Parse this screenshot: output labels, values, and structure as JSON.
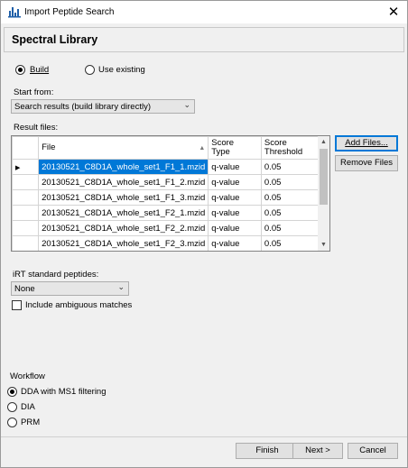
{
  "window": {
    "title": "Import Peptide Search",
    "close_glyph": "✕"
  },
  "header": {
    "title": "Spectral Library"
  },
  "library_mode": {
    "build_label": "Build",
    "use_existing_label": "Use existing",
    "selected": "Build"
  },
  "start_from": {
    "label": "Start from:",
    "value": "Search results (build library directly)"
  },
  "result_files": {
    "label": "Result files:",
    "columns": [
      "File",
      "Score Type",
      "Score Threshold"
    ],
    "column_lines": {
      "score_type": [
        "Score",
        "Type"
      ],
      "score_threshold": [
        "Score",
        "Threshold"
      ]
    },
    "rows": [
      {
        "file": "20130521_C8D1A_whole_set1_F1_1.mzid",
        "score_type": "q-value",
        "threshold": "0.05",
        "current": true
      },
      {
        "file": "20130521_C8D1A_whole_set1_F1_2.mzid",
        "score_type": "q-value",
        "threshold": "0.05"
      },
      {
        "file": "20130521_C8D1A_whole_set1_F1_3.mzid",
        "score_type": "q-value",
        "threshold": "0.05"
      },
      {
        "file": "20130521_C8D1A_whole_set1_F2_1.mzid",
        "score_type": "q-value",
        "threshold": "0.05"
      },
      {
        "file": "20130521_C8D1A_whole_set1_F2_2.mzid",
        "score_type": "q-value",
        "threshold": "0.05"
      },
      {
        "file": "20130521_C8D1A_whole_set1_F2_3.mzid",
        "score_type": "q-value",
        "threshold": "0.05"
      }
    ],
    "current_row_glyph": "▶",
    "add_files_label": "Add Files...",
    "remove_files_label": "Remove Files"
  },
  "irt": {
    "label": "iRT standard peptides:",
    "value": "None"
  },
  "ambiguous": {
    "label": "Include ambiguous matches",
    "checked": false
  },
  "workflow": {
    "label": "Workflow",
    "options": [
      "DDA with MS1 filtering",
      "DIA",
      "PRM"
    ],
    "selected": "DDA with MS1 filtering"
  },
  "footer": {
    "finish_label": "Finish",
    "next_label": "Next >",
    "cancel_label": "Cancel"
  },
  "colors": {
    "selection": "#0078d7",
    "accent_focus": "#0078d7"
  }
}
